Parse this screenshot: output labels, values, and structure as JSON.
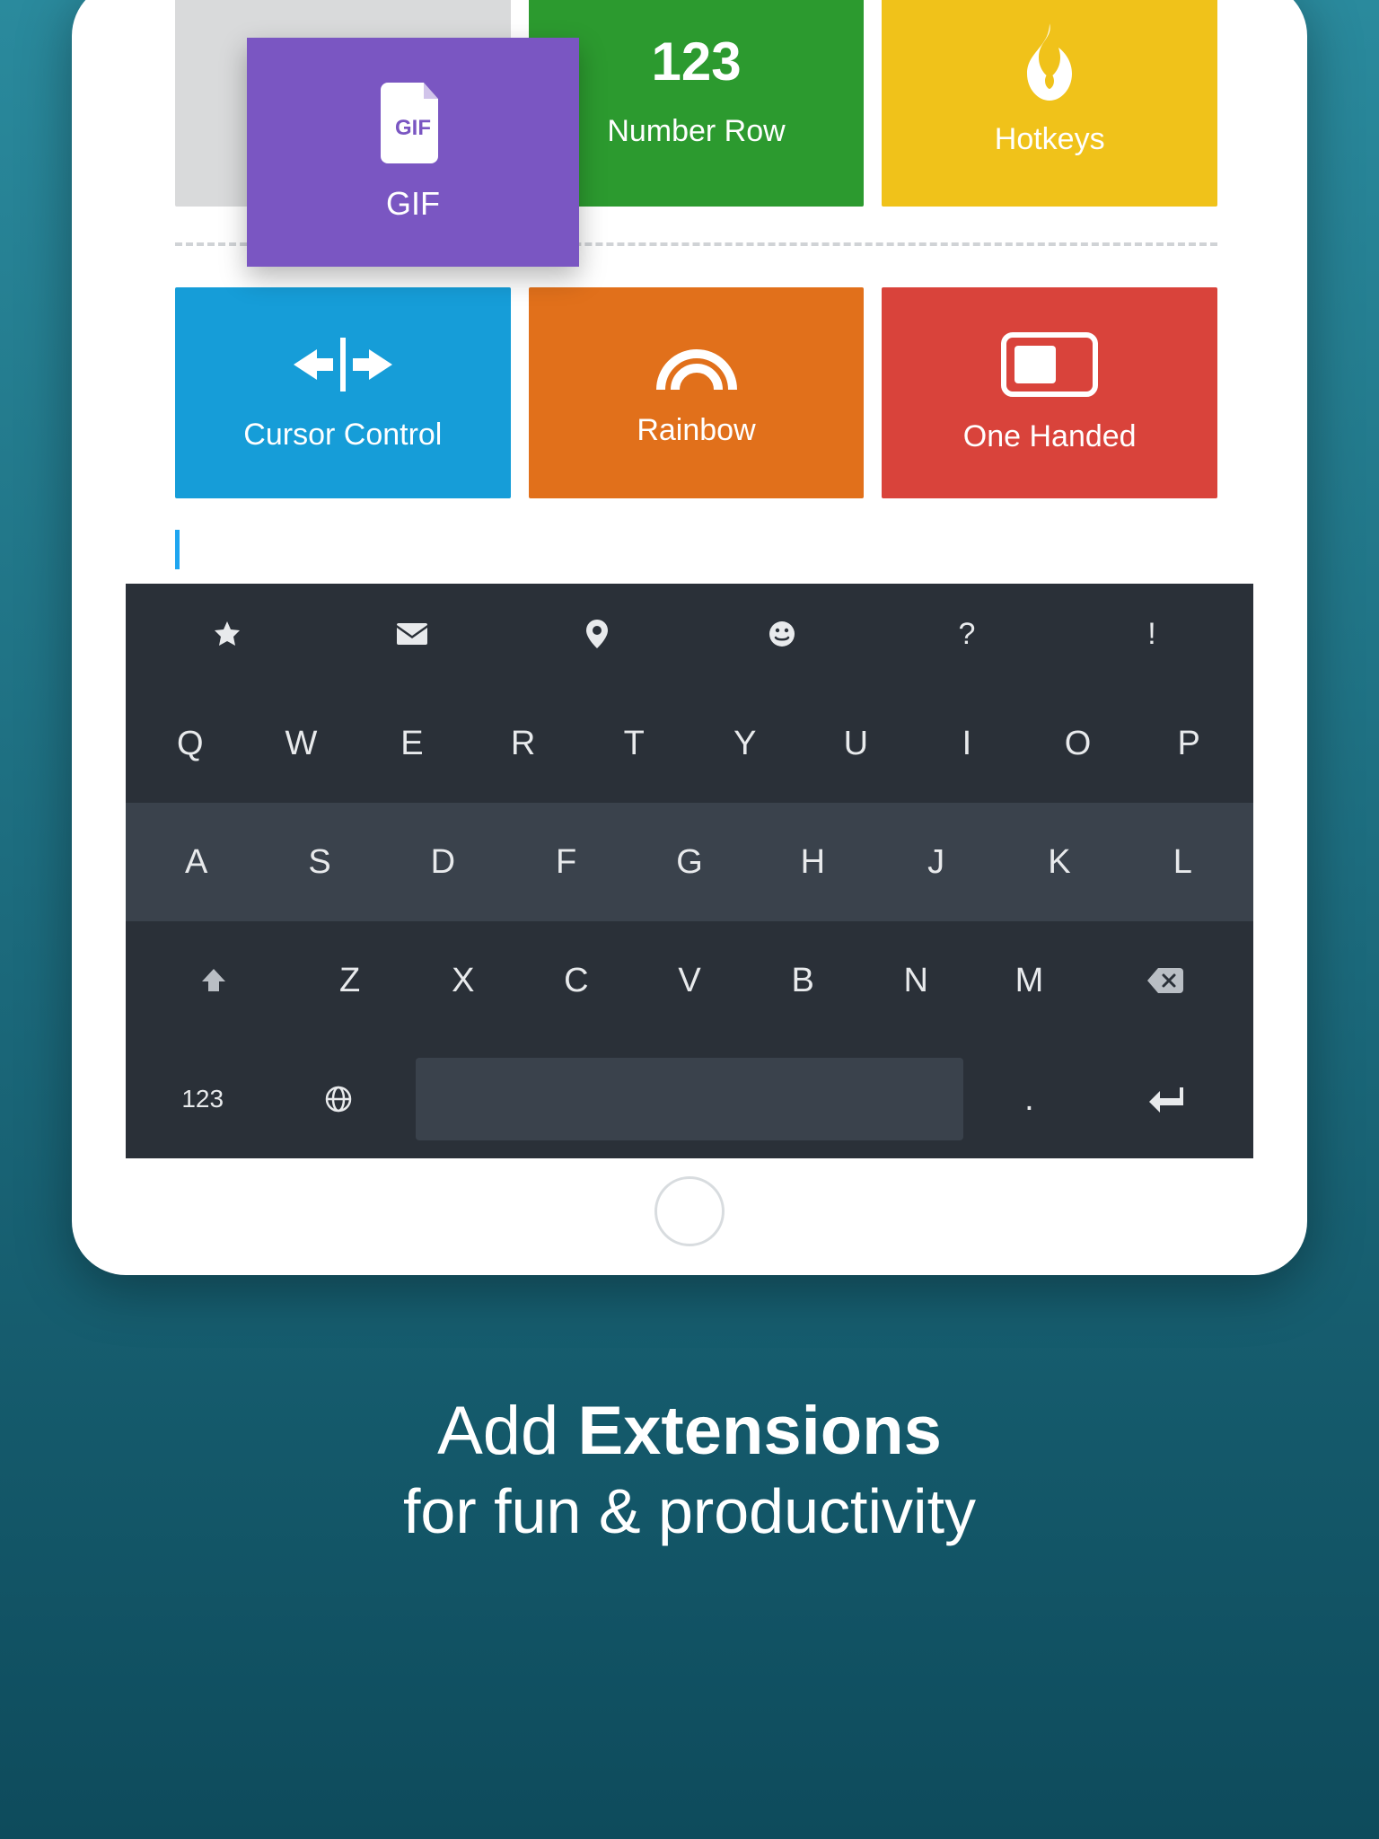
{
  "tiles": {
    "floating": {
      "label": "GIF",
      "icon_text": "GIF",
      "color": "#7a56c2"
    },
    "row1": [
      {
        "label": "",
        "color": "#d9dadb",
        "is_placeholder": true
      },
      {
        "label": "Number Row",
        "big_text": "123",
        "color": "#2c9a2f"
      },
      {
        "label": "Hotkeys",
        "color": "#f0c21a"
      }
    ],
    "row2": [
      {
        "label": "Cursor Control",
        "color": "#169dd8"
      },
      {
        "label": "Rainbow",
        "color": "#e1701b"
      },
      {
        "label": "One Handed",
        "color": "#d9433b"
      }
    ],
    "row3": [
      {
        "label": "",
        "color": "#9dc242"
      },
      {
        "label": "",
        "color": "#b2c94c"
      },
      {
        "label": "",
        "color": "#ed1e9a"
      }
    ]
  },
  "keyboard": {
    "shortcut_row": [
      "star-icon",
      "mail-icon",
      "pin-icon",
      "smile-icon",
      "?",
      "!"
    ],
    "row_q": [
      "Q",
      "W",
      "E",
      "R",
      "T",
      "Y",
      "U",
      "I",
      "O",
      "P"
    ],
    "row_a": [
      "A",
      "S",
      "D",
      "F",
      "G",
      "H",
      "J",
      "K",
      "L"
    ],
    "row_z": [
      "shift-icon",
      "Z",
      "X",
      "C",
      "V",
      "B",
      "N",
      "M",
      "backspace-icon"
    ],
    "row_bottom": {
      "numkey": "123",
      "globe": "globe-icon",
      "period": ".",
      "enter": "enter-icon"
    }
  },
  "caption": {
    "line1_pre": "Add ",
    "line1_bold": "Extensions",
    "line2": "for fun & productivity"
  }
}
